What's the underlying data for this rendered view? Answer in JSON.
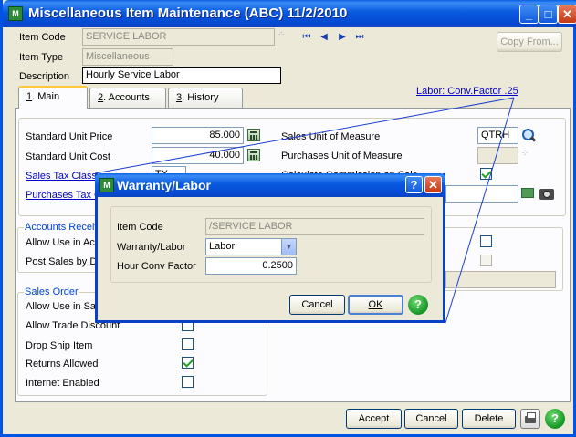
{
  "window": {
    "title": "Miscellaneous Item Maintenance (ABC) 11/2/2010",
    "app_icon_text": "M",
    "minimize": "_",
    "maximize": "□",
    "close": "✕"
  },
  "header": {
    "item_code_label": "Item Code",
    "item_code_value": "SERVICE LABOR",
    "item_type_label": "Item Type",
    "item_type_value": "Miscellaneous",
    "description_label": "Description",
    "description_value": "Hourly Service Labor",
    "copy_from_label": "Copy From...",
    "nav": [
      "⏮",
      "◀",
      "▶",
      "⏭"
    ]
  },
  "tabs": [
    {
      "key": "1",
      "label": ". Main"
    },
    {
      "key": "2",
      "label": ". Accounts"
    },
    {
      "key": "3",
      "label": ". History"
    }
  ],
  "tooltip_link": "Labor: Conv.Factor .25",
  "main": {
    "std_unit_price_label": "Standard Unit Price",
    "std_unit_price_value": "85.000",
    "std_unit_cost_label": "Standard Unit Cost",
    "std_unit_cost_value": "40.000",
    "sales_tax_class_label": "Sales Tax Class",
    "sales_tax_class_value": "TX",
    "purchases_tax_label": "Purchases Tax C",
    "sales_uom_label": "Sales Unit of Measure",
    "sales_uom_value": "QTRH",
    "purchases_uom_label": "Purchases Unit of Measure",
    "calc_commission_label": "Calculate Commission on Sale",
    "accounts_receivable_group": "Accounts Receiv",
    "allow_use_acc_label": "Allow Use in Acc",
    "post_sales_label": "Post Sales by Div",
    "sales_order_group": "Sales Order",
    "allow_use_sales_label": "Allow Use in Sale",
    "allow_trade_label": "Allow Trade Discount",
    "drop_ship_label": "Drop Ship Item",
    "returns_allowed_label": "Returns Allowed",
    "internet_enabled_label": "Internet Enabled"
  },
  "footer": {
    "accept": "Accept",
    "cancel": "Cancel",
    "delete": "Delete",
    "help": "?"
  },
  "dialog": {
    "title": "Warranty/Labor",
    "help_title_btn": "?",
    "close_btn": "✕",
    "item_code_label": "Item Code",
    "item_code_value": "/SERVICE LABOR",
    "warranty_labor_label": "Warranty/Labor",
    "warranty_labor_value": "Labor",
    "hour_conv_label": "Hour Conv Factor",
    "hour_conv_value": "0.2500",
    "cancel": "Cancel",
    "ok": "OK",
    "help": "?"
  }
}
